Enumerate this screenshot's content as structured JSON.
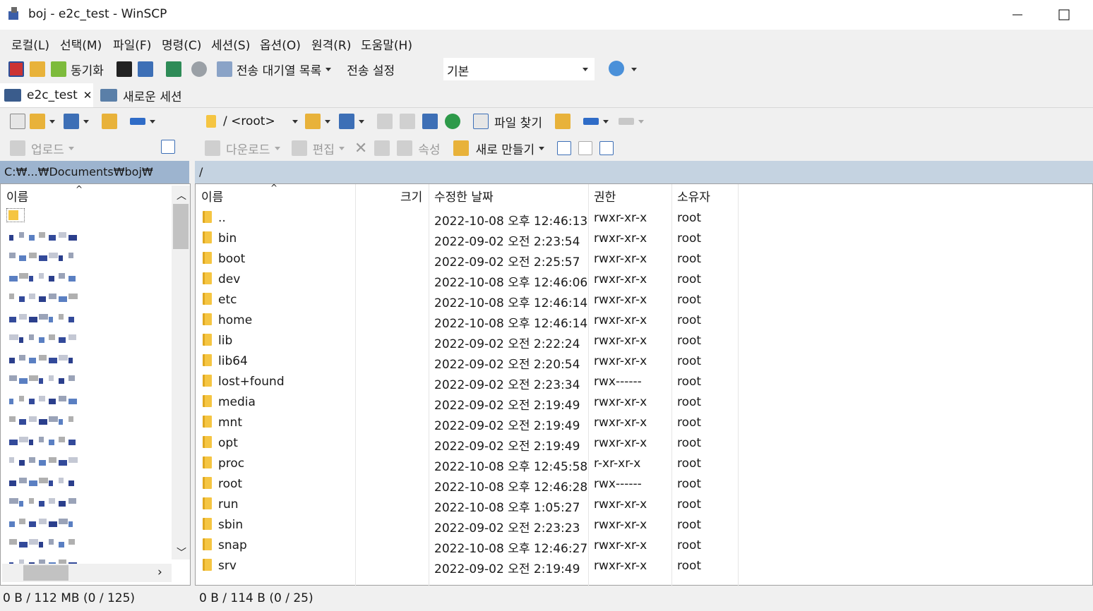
{
  "window": {
    "title": "boj - e2c_test - WinSCP"
  },
  "menu": [
    "로컬(L)",
    "선택(M)",
    "파일(F)",
    "명령(C)",
    "세션(S)",
    "옵션(O)",
    "원격(R)",
    "도움말(H)"
  ],
  "toolbar": {
    "sync_label": "동기화",
    "queue_label": "전송 대기열 목록",
    "transfer_setting_label": "전송 설정",
    "transfer_setting_value": "기본"
  },
  "tabs": [
    {
      "label": "e2c_test"
    },
    {
      "label": "새로운 세션"
    }
  ],
  "local": {
    "upload_label": "업로드",
    "path": "C:₩...₩Documents₩boj₩",
    "col_name": "이름",
    "status": "0 B / 112 MB (0 / 125)"
  },
  "remote": {
    "path_combo": "/ <root>",
    "find_label": "파일 찾기",
    "download_label": "다운로드",
    "edit_label": "편집",
    "props_label": "속성",
    "new_label": "새로 만들기",
    "path": "/",
    "columns": {
      "name": "이름",
      "size": "크기",
      "modified": "수정한 날짜",
      "rights": "권한",
      "owner": "소유자"
    },
    "status": "0 B / 114 B (0 / 25)",
    "files": [
      {
        "name": "..",
        "modified": "2022-10-08 오후 12:46:13",
        "rights": "rwxr-xr-x",
        "owner": "root"
      },
      {
        "name": "bin",
        "modified": "2022-09-02 오전 2:23:54",
        "rights": "rwxr-xr-x",
        "owner": "root"
      },
      {
        "name": "boot",
        "modified": "2022-09-02 오전 2:25:57",
        "rights": "rwxr-xr-x",
        "owner": "root"
      },
      {
        "name": "dev",
        "modified": "2022-10-08 오후 12:46:06",
        "rights": "rwxr-xr-x",
        "owner": "root"
      },
      {
        "name": "etc",
        "modified": "2022-10-08 오후 12:46:14",
        "rights": "rwxr-xr-x",
        "owner": "root"
      },
      {
        "name": "home",
        "modified": "2022-10-08 오후 12:46:14",
        "rights": "rwxr-xr-x",
        "owner": "root"
      },
      {
        "name": "lib",
        "modified": "2022-09-02 오전 2:22:24",
        "rights": "rwxr-xr-x",
        "owner": "root"
      },
      {
        "name": "lib64",
        "modified": "2022-09-02 오전 2:20:54",
        "rights": "rwxr-xr-x",
        "owner": "root"
      },
      {
        "name": "lost+found",
        "modified": "2022-09-02 오전 2:23:34",
        "rights": "rwx------",
        "owner": "root"
      },
      {
        "name": "media",
        "modified": "2022-09-02 오전 2:19:49",
        "rights": "rwxr-xr-x",
        "owner": "root"
      },
      {
        "name": "mnt",
        "modified": "2022-09-02 오전 2:19:49",
        "rights": "rwxr-xr-x",
        "owner": "root"
      },
      {
        "name": "opt",
        "modified": "2022-09-02 오전 2:19:49",
        "rights": "rwxr-xr-x",
        "owner": "root"
      },
      {
        "name": "proc",
        "modified": "2022-10-08 오후 12:45:58",
        "rights": "r-xr-xr-x",
        "owner": "root"
      },
      {
        "name": "root",
        "modified": "2022-10-08 오후 12:46:28",
        "rights": "rwx------",
        "owner": "root"
      },
      {
        "name": "run",
        "modified": "2022-10-08 오후 1:05:27",
        "rights": "rwxr-xr-x",
        "owner": "root"
      },
      {
        "name": "sbin",
        "modified": "2022-09-02 오전 2:23:23",
        "rights": "rwxr-xr-x",
        "owner": "root"
      },
      {
        "name": "snap",
        "modified": "2022-10-08 오후 12:46:27",
        "rights": "rwxr-xr-x",
        "owner": "root"
      },
      {
        "name": "srv",
        "modified": "2022-09-02 오전 2:19:49",
        "rights": "rwxr-xr-x",
        "owner": "root"
      }
    ]
  }
}
